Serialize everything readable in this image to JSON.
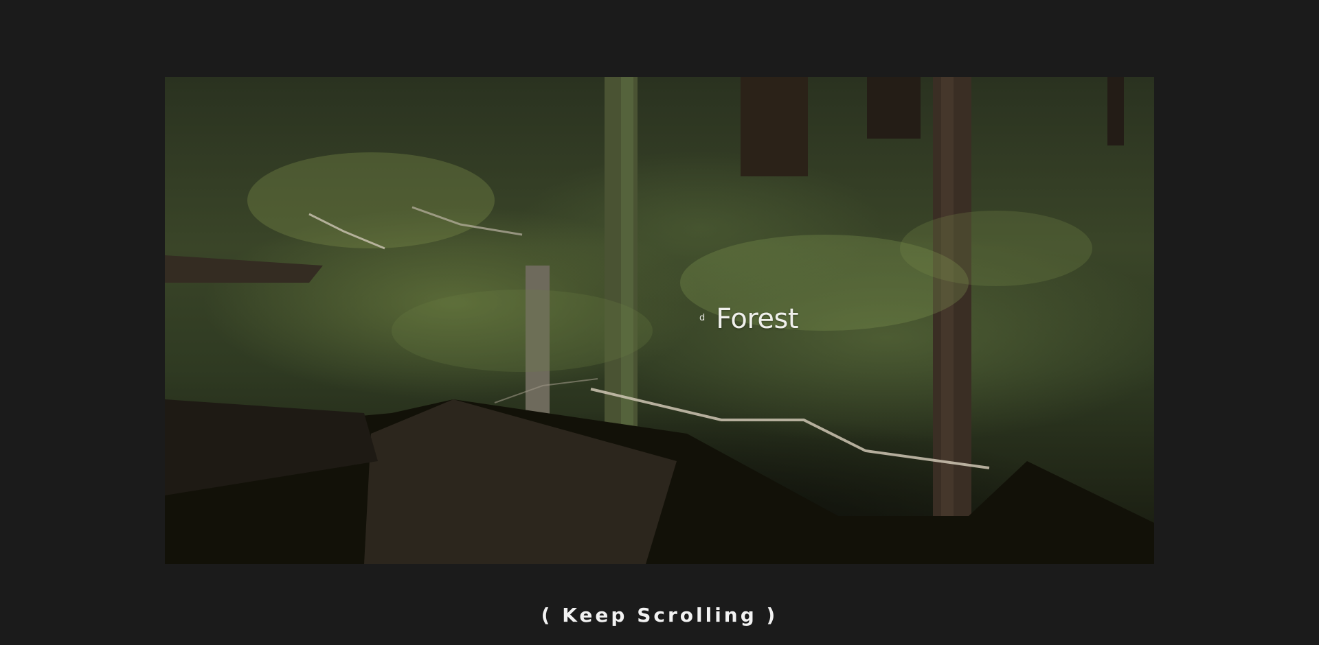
{
  "hero": {
    "image_description_icon": "forest-photo",
    "superscript": "d",
    "title": "Forest"
  },
  "footer": {
    "scroll_hint": "( Keep Scrolling )"
  },
  "colors": {
    "background": "#1b1b1b",
    "text": "#f0f0ec"
  }
}
